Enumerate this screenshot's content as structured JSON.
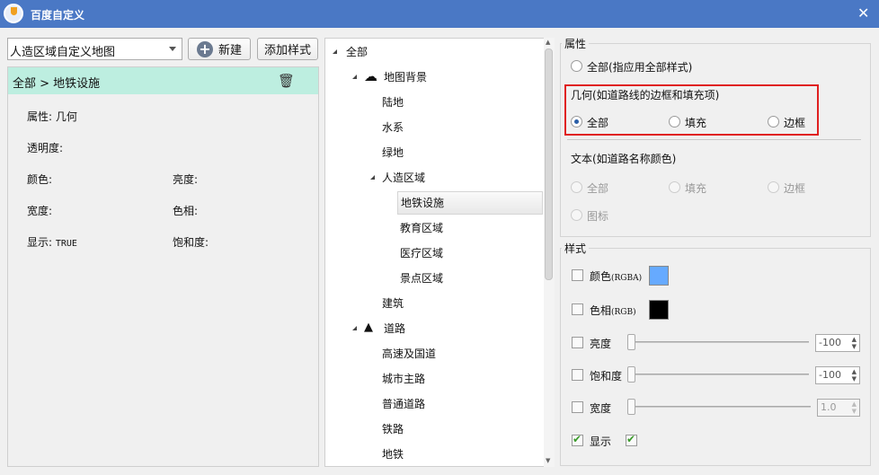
{
  "window": {
    "title": "百度自定义",
    "close": "✕"
  },
  "toolbar": {
    "map_select": "人造区域自定义地图",
    "new_label": "新建",
    "add_style_label": "添加样式"
  },
  "left": {
    "breadcrumb": "全部 > 地铁设施",
    "props": [
      {
        "label": "属性:",
        "value": "几何"
      },
      {
        "label": "透明度:",
        "value": ""
      },
      {
        "label": "颜色:",
        "value": ""
      },
      {
        "label": "亮度:",
        "value": ""
      },
      {
        "label": "宽度:",
        "value": ""
      },
      {
        "label": "色相:",
        "value": ""
      },
      {
        "label": "显示:",
        "value": "TRUE"
      },
      {
        "label": "饱和度:",
        "value": ""
      }
    ]
  },
  "tree": {
    "items": [
      "全部",
      "地图背景",
      "陆地",
      "水系",
      "绿地",
      "人造区域",
      "地铁设施",
      "教育区域",
      "医疗区域",
      "景点区域",
      "建筑",
      "道路",
      "高速及国道",
      "城市主路",
      "普通道路",
      "铁路",
      "地铁"
    ],
    "selected": "地铁设施"
  },
  "attributes": {
    "group_label": "属性",
    "all_label": "全部(指应用全部样式)",
    "geometry": {
      "label": "几何(如道路线的边框和填充项)",
      "options": [
        "全部",
        "填充",
        "边框"
      ],
      "selected": "全部"
    },
    "text": {
      "label": "文本(如道路名称颜色)",
      "options": [
        "全部",
        "填充",
        "边框",
        "图标"
      ]
    }
  },
  "style": {
    "group_label": "样式",
    "color_label": "颜色",
    "color_suffix": "(RGBA)",
    "color_value": "#66aaff",
    "hue_label": "色相",
    "hue_suffix": "(RGB)",
    "hue_value": "#000000",
    "brightness_label": "亮度",
    "brightness_value": "-100",
    "saturation_label": "饱和度",
    "saturation_value": "-100",
    "width_label": "宽度",
    "width_value": "1.0",
    "show_label": "显示",
    "show_checked": true
  },
  "colors": {
    "titlebar": "#4a78c5",
    "breadcrumb_bg": "#bdeee0",
    "highlight": "#e02020"
  }
}
